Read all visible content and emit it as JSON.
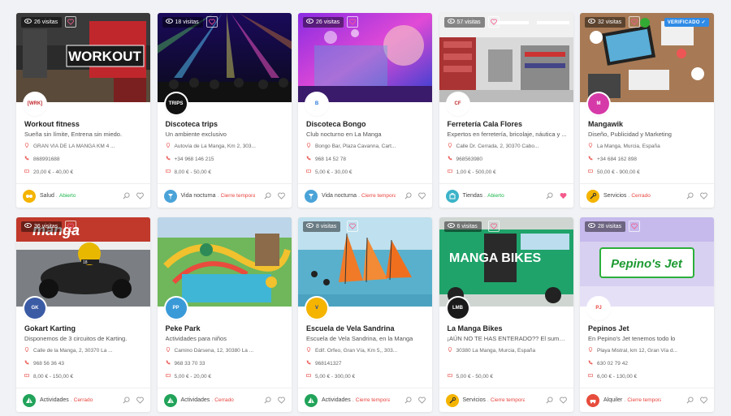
{
  "cards": [
    {
      "title": "Workout fitness",
      "subtitle": "Sueña sin límite, Entrena sin miedo.",
      "address": "GRAN VIA DE LA MANGA KM 4 ...",
      "phone": "868991688",
      "price": "20,00 € - 40,00 €",
      "category": "Salud",
      "status": "Abierto",
      "status_type": "open",
      "visits": "26 visitas",
      "favorited": false,
      "verified": false,
      "verified_label": "",
      "logo_text": "[WRK]",
      "colors": {
        "cat": "#f4b400"
      }
    },
    {
      "title": "Discoteca trips",
      "subtitle": "Un ambiente exclusivo",
      "address": "Autovía de La Manga, Km 2, 303...",
      "phone": "+34 968 146 215",
      "price": "8,00 € - 50,00 €",
      "category": "Vida nocturna",
      "status": "Cierre temporal",
      "status_type": "closed",
      "visits": "18 visitas",
      "favorited": false,
      "verified": false,
      "verified_label": "",
      "logo_text": "TRIPS",
      "colors": {
        "cat": "#4aa3d8"
      }
    },
    {
      "title": "Discoteca Bongo",
      "subtitle": "Club nocturno en La Manga",
      "address": "Bongo Bar, Plaza Cavanna, Cart...",
      "phone": "968 14 52 78",
      "price": "5,00 € - 30,00 €",
      "category": "Vida nocturna",
      "status": "Cierre temporal",
      "status_type": "closed",
      "visits": "26 visitas",
      "favorited": false,
      "verified": false,
      "verified_label": "",
      "logo_text": "B",
      "colors": {
        "cat": "#4aa3d8"
      }
    },
    {
      "title": "Ferretería Cala Flores",
      "subtitle": "Expertos en ferretería, bricolaje, náutica y ...",
      "address": "Calle Dr. Cerrada, 2, 30370 Cabo...",
      "phone": "968563980",
      "price": "1,00 € - 500,00 €",
      "category": "Tiendas",
      "status": "Abierto",
      "status_type": "open",
      "visits": "57 visitas",
      "favorited": true,
      "verified": false,
      "verified_label": "",
      "logo_text": "CF",
      "colors": {
        "cat": "#3bb3c9"
      }
    },
    {
      "title": "Mangawik",
      "subtitle": "Diseño, Publicidad y Marketing",
      "address": "La Manga, Murcia, España",
      "phone": "+34 684 162 898",
      "price": "50,00 € - 900,00 €",
      "category": "Servicios",
      "status": "Cerrado",
      "status_type": "closed",
      "visits": "32 visitas",
      "favorited": false,
      "verified": true,
      "verified_label": "VERIFICADO ✓",
      "logo_text": "M",
      "colors": {
        "cat": "#f4b400"
      }
    },
    {
      "title": "Gokart Karting",
      "subtitle": "Disponemos de 3 circuitos de Karting.",
      "address": "Calle de la Manga, 2, 30370 La ...",
      "phone": "968 56 36 43",
      "price": "8,00 € - 150,00 €",
      "category": "Actividades",
      "status": "Cerrado",
      "status_type": "closed",
      "visits": "36 visitas",
      "favorited": false,
      "verified": false,
      "verified_label": "",
      "logo_text": "GK",
      "colors": {
        "cat": "#22a35a"
      }
    },
    {
      "title": "Peke Park",
      "subtitle": "Actividades para niños",
      "address": "Camino Dársena, 12, 30380 La ...",
      "phone": "968 33 70 33",
      "price": "5,00 € - 20,00 €",
      "category": "Actividades",
      "status": "Cerrado",
      "status_type": "closed",
      "visits": "",
      "favorited": false,
      "verified": false,
      "verified_label": "",
      "logo_text": "PP",
      "colors": {
        "cat": "#22a35a"
      }
    },
    {
      "title": "Escuela de Vela Sandrina",
      "subtitle": "Escuela de Vela Sandrina, en la Manga",
      "address": "Edif. Orfeo, Gran Vía, Km 5,, 303...",
      "phone": "968141327",
      "price": "5,00 € - 300,00 €",
      "category": "Actividades",
      "status": "Cierre temporal",
      "status_type": "closed",
      "visits": "8 visitas",
      "favorited": false,
      "verified": false,
      "verified_label": "",
      "logo_text": "V",
      "colors": {
        "cat": "#22a35a"
      }
    },
    {
      "title": "La Manga Bikes",
      "subtitle": "¡AÚN NO TE HAS ENTERADO?? El summu...",
      "address": "30380 La Manga, Murcia, España",
      "phone": "",
      "price": "5,00 € - 50,00 €",
      "category": "Servicios",
      "status": "Cierre temporal",
      "status_type": "closed",
      "visits": "6 visitas",
      "favorited": false,
      "verified": false,
      "verified_label": "",
      "logo_text": "LMB",
      "colors": {
        "cat": "#f4b400"
      }
    },
    {
      "title": "Pepinos Jet",
      "subtitle": "En Pepino's Jet tenemos todo lo",
      "address": "Playa Mistral, km 12, Gran Vía d...",
      "phone": "630 02 79 42",
      "price": "6,00 € - 130,00 €",
      "category": "Alquiler",
      "status": "Cierre temporal",
      "status_type": "closed",
      "visits": "28 visitas",
      "favorited": false,
      "verified": false,
      "verified_label": "",
      "logo_text": "PJ",
      "colors": {
        "cat": "#e74c3c"
      }
    }
  ],
  "images": [
    "gym",
    "club-lights",
    "club-purple",
    "hardware-store",
    "desk",
    "karting",
    "water-park",
    "windsurf",
    "van",
    "jet-banner"
  ],
  "image_text": {
    "gym": "WORKOUT",
    "van": "MANGA BIKES",
    "jet": "Pepino's Jet"
  },
  "icons": {
    "visits": "eye-icon",
    "favorite": "heart-icon",
    "share": "magnifier-icon",
    "address": "pin-icon",
    "phone": "phone-icon",
    "price": "ticket-icon"
  }
}
